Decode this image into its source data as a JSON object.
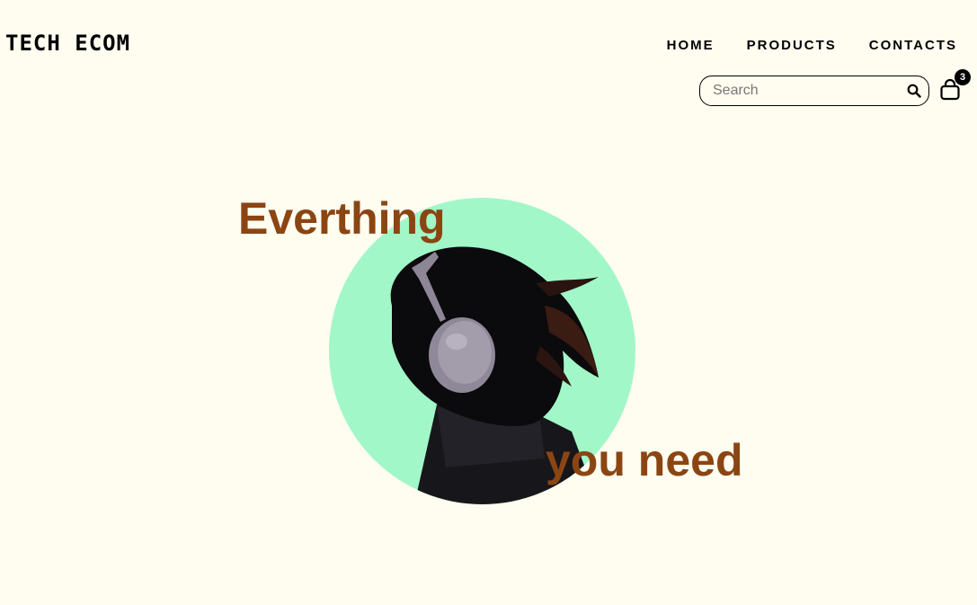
{
  "header": {
    "logo_text": "TECH ECOM"
  },
  "nav": {
    "items": [
      {
        "label": "HOME"
      },
      {
        "label": "PRODUCTS"
      },
      {
        "label": "CONTACTS"
      }
    ]
  },
  "search": {
    "placeholder": "Search",
    "icon": "search-icon"
  },
  "cart": {
    "icon": "shopping-bag-icon",
    "count": "3"
  },
  "hero": {
    "line1": "Everthing",
    "line2": "you need",
    "text_color": "#8b4513",
    "circle_color": "#a2f7c8",
    "image": "woman-with-headphones"
  },
  "colors": {
    "background": "#fffcf0"
  }
}
